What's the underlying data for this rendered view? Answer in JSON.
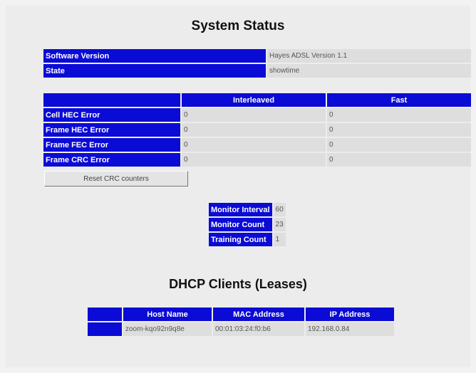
{
  "page_title": "System Status",
  "info": [
    {
      "label": "Software Version",
      "value": "Hayes ADSL Version 1.1"
    },
    {
      "label": "State",
      "value": "showtime"
    }
  ],
  "errors": {
    "headers": [
      "",
      "Interleaved",
      "Fast"
    ],
    "rows": [
      {
        "label": "Cell HEC Error",
        "interleaved": "0",
        "fast": "0"
      },
      {
        "label": "Frame HEC Error",
        "interleaved": "0",
        "fast": "0"
      },
      {
        "label": "Frame FEC Error",
        "interleaved": "0",
        "fast": "0"
      },
      {
        "label": "Frame CRC Error",
        "interleaved": "0",
        "fast": "0"
      }
    ]
  },
  "reset_button": "Reset CRC counters",
  "monitor": [
    {
      "label": "Monitor Interval",
      "value": "60"
    },
    {
      "label": "Monitor Count",
      "value": "23"
    },
    {
      "label": "Training Count",
      "value": "1"
    }
  ],
  "dhcp": {
    "title": "DHCP Clients (Leases)",
    "headers": [
      "",
      "Host Name",
      "MAC Address",
      "IP Address"
    ],
    "rows": [
      {
        "host": "zoom-kqo92n9q8e",
        "mac": "00:01:03:24:f0:b6",
        "ip": "192.168.0.84"
      }
    ]
  },
  "colors": {
    "header_blue": "#0b0bd6",
    "value_gray": "#dedede"
  }
}
